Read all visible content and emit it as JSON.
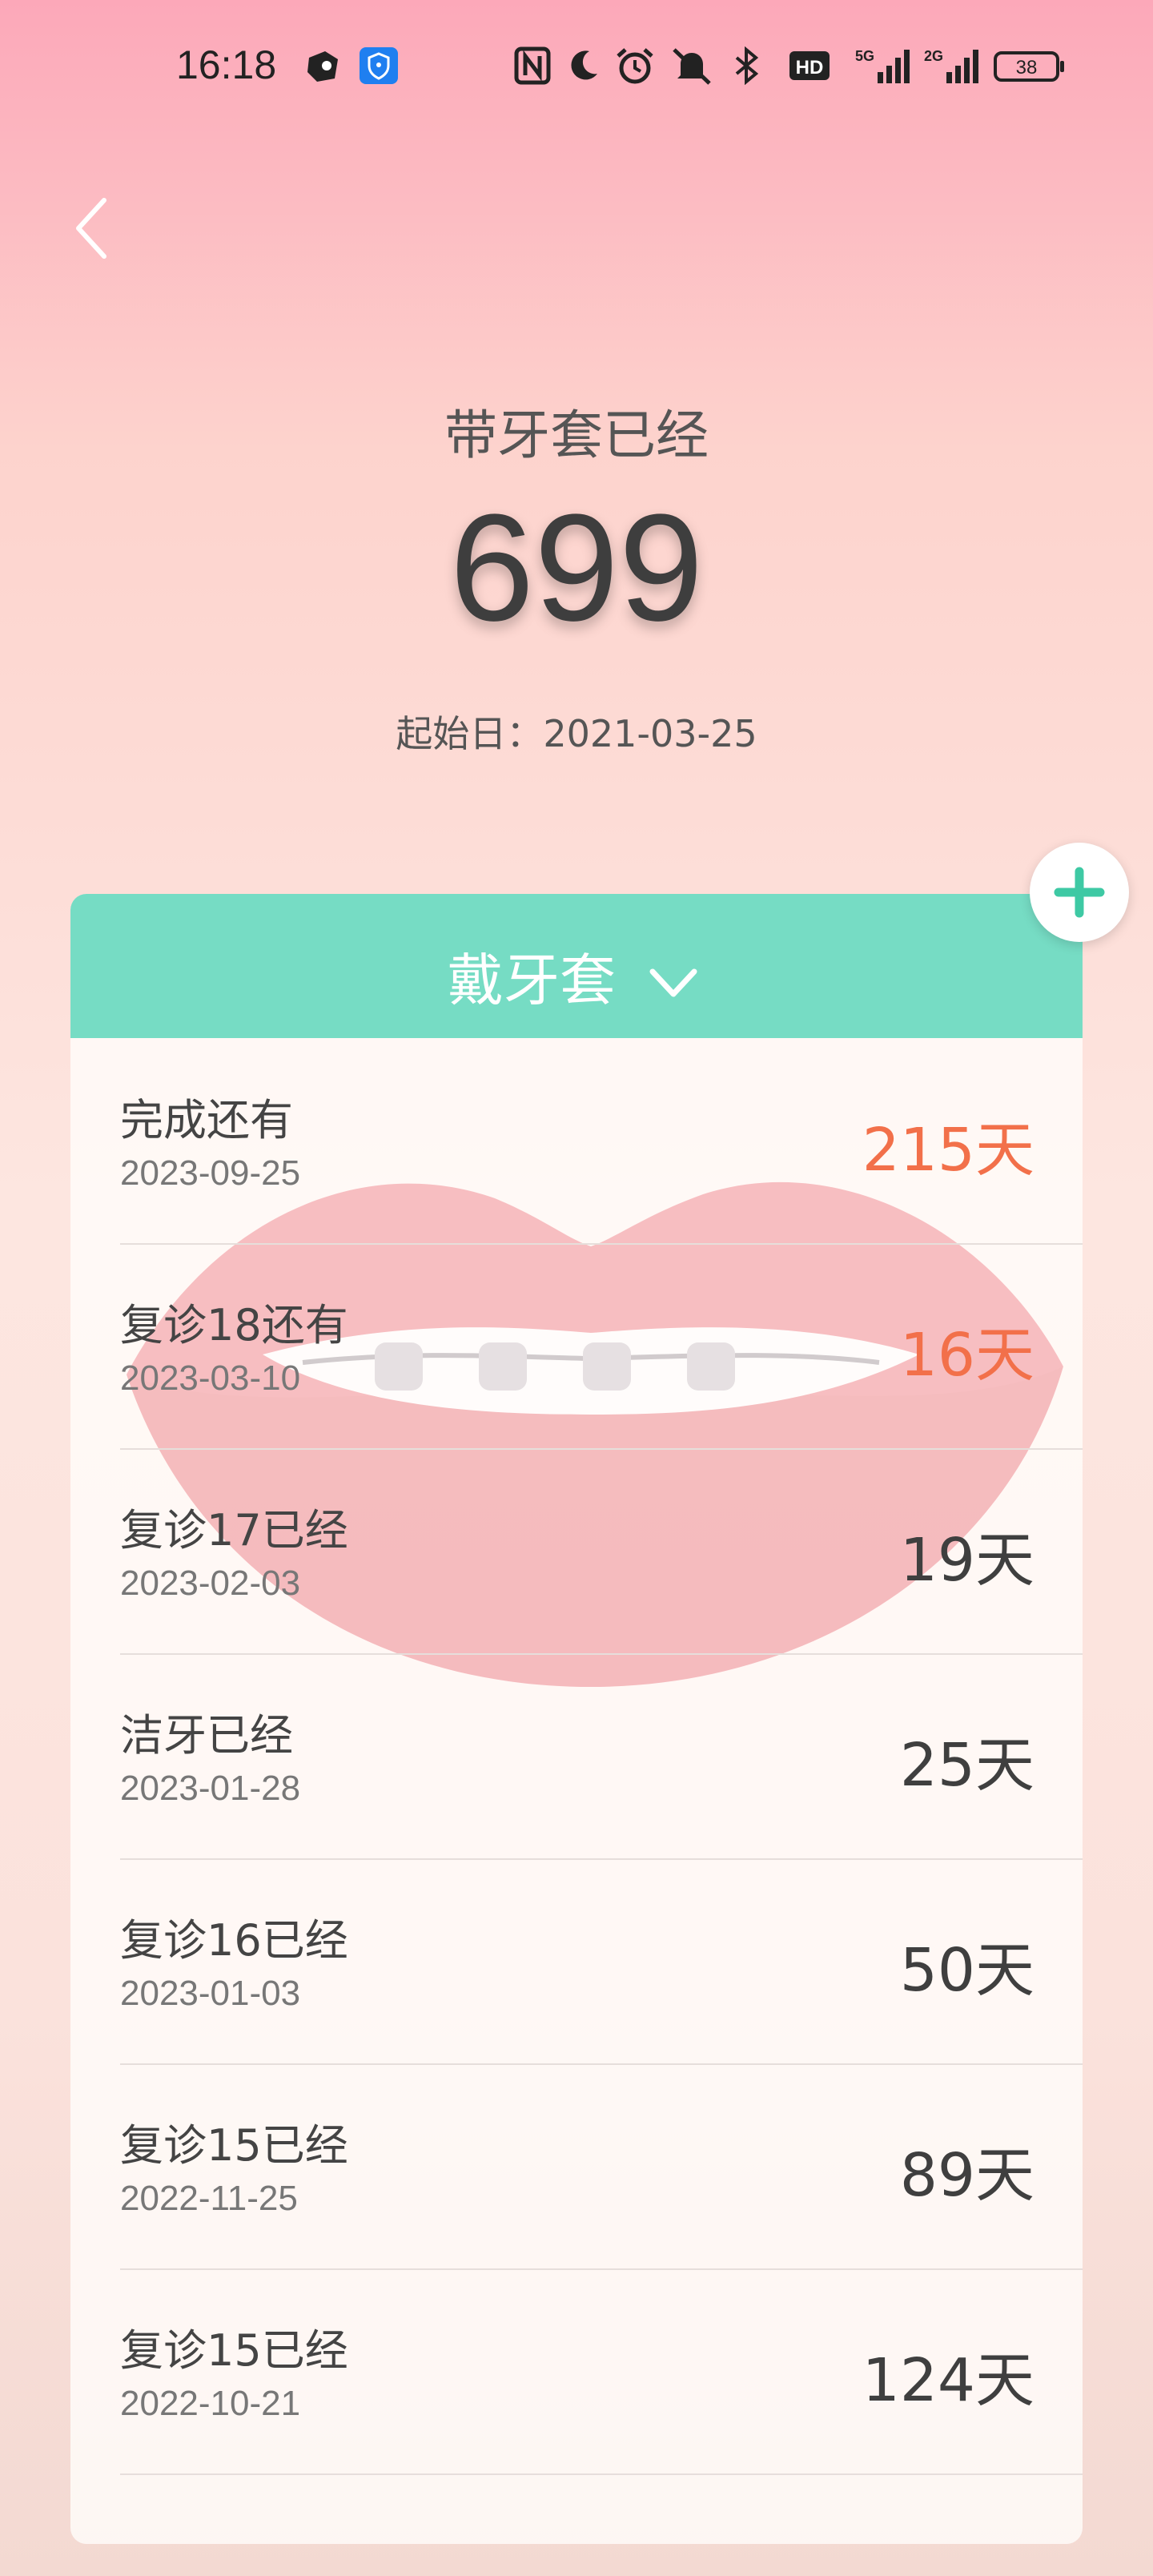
{
  "status_bar": {
    "time": "16:18",
    "icons": [
      "app-icon",
      "shield-icon",
      "nfc-icon",
      "moon-icon",
      "alarm-icon",
      "mute-icon",
      "bluetooth-icon",
      "hd-icon",
      "signal-5g-icon",
      "signal-2g-icon",
      "battery-icon"
    ],
    "hd_label": "HD",
    "net1_label": "5G",
    "net2_label": "2G",
    "battery_level": "38"
  },
  "hero": {
    "title": "带牙套已经",
    "days": "699",
    "start_label": "起始日：2021-03-25"
  },
  "card": {
    "header_label": "戴牙套",
    "accent_color": "#76dcc4",
    "future_color": "#f2704a",
    "rows": [
      {
        "name": "完成还有",
        "date": "2023-09-25",
        "days": "215天",
        "future": true
      },
      {
        "name": "复诊18还有",
        "date": "2023-03-10",
        "days": "16天",
        "future": true
      },
      {
        "name": "复诊17已经",
        "date": "2023-02-03",
        "days": "19天",
        "future": false
      },
      {
        "name": "洁牙已经",
        "date": "2023-01-28",
        "days": "25天",
        "future": false
      },
      {
        "name": "复诊16已经",
        "date": "2023-01-03",
        "days": "50天",
        "future": false
      },
      {
        "name": "复诊15已经",
        "date": "2022-11-25",
        "days": "89天",
        "future": false
      },
      {
        "name": "复诊15已经",
        "date": "2022-10-21",
        "days": "124天",
        "future": false
      }
    ]
  }
}
